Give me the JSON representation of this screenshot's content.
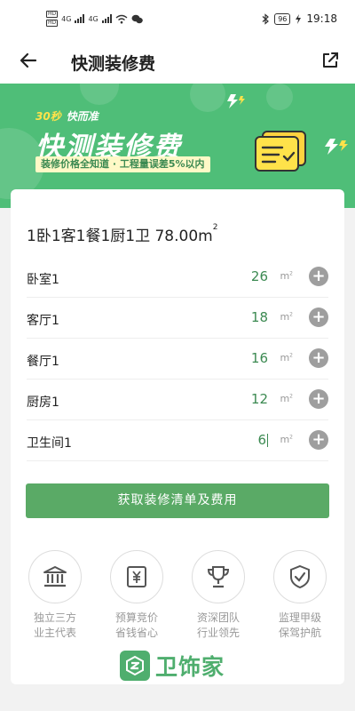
{
  "statusbar": {
    "time": "19:18",
    "battery": "96",
    "sim1": "HD",
    "sim2": "HD",
    "net1": "4G",
    "net2": "4G"
  },
  "appbar": {
    "title": "快测装修费"
  },
  "banner": {
    "tag_a": "30秒",
    "tag_b": "快而准",
    "headline": "快测装修费",
    "subline": "装修价格全知道 · 工程量误差5%以内"
  },
  "summary": {
    "text": "1卧1客1餐1厨1卫  78.00m",
    "sup": "2"
  },
  "unit": {
    "base": "m",
    "sup": "2"
  },
  "rooms": [
    {
      "label": "卧室1",
      "value": "26"
    },
    {
      "label": "客厅1",
      "value": "18"
    },
    {
      "label": "餐厅1",
      "value": "16"
    },
    {
      "label": "厨房1",
      "value": "12"
    },
    {
      "label": "卫生间1",
      "value": "6"
    }
  ],
  "plus_symbol": "+",
  "cta": {
    "label": "获取装修清单及费用"
  },
  "features": [
    {
      "icon": "bank-icon",
      "line1": "独立三方",
      "line2": "业主代表"
    },
    {
      "icon": "yuan-doc-icon",
      "line1": "预算竞价",
      "line2": "省钱省心"
    },
    {
      "icon": "trophy-icon",
      "line1": "资深团队",
      "line2": "行业领先"
    },
    {
      "icon": "shield-check-icon",
      "line1": "监理甲级",
      "line2": "保驾护航"
    }
  ],
  "brand": {
    "name": "卫饰家"
  },
  "colors": {
    "green": "#4fbe78",
    "button": "#5aaa66",
    "value": "#3c8a52",
    "yellow": "#ffe24a"
  }
}
